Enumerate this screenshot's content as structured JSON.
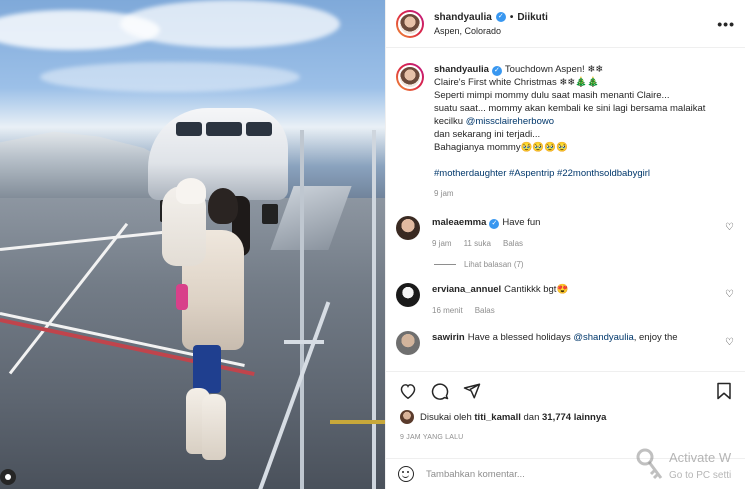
{
  "post": {
    "username": "shandyaulia",
    "follow_label": "Diikuti",
    "dot": "•",
    "location": "Aspen, Colorado",
    "more": "•••"
  },
  "caption": {
    "username": "shandyaulia",
    "lines": [
      "Touchdown Aspen! ❄❄",
      "Claire's First white Christmas ❄❄🎄🎄",
      "Seperti mimpi mommy dulu saat masih menanti Claire...",
      "suatu saat... mommy akan kembali ke sini lagi bersama malaikat",
      "kecilku "
    ],
    "mention": "@missclaireherbowo",
    "lines2": [
      "dan sekarang ini terjadi...",
      "Bahagianya mommy🥹🥹🥹🥹"
    ],
    "hashtags": "#motherdaughter #Aspentrip #22monthsoldbabygirl",
    "time": "9 jam"
  },
  "comments": [
    {
      "username": "maleaemma",
      "verified": true,
      "text": "Have fun",
      "time": "9 jam",
      "likes": "11 suka",
      "reply": "Balas",
      "replies": "Lihat balasan (7)"
    },
    {
      "username": "erviana_annuel",
      "verified": false,
      "text": "Cantikkk bgt😍",
      "time": "16 menit",
      "reply": "Balas"
    },
    {
      "username": "sawirin",
      "verified": false,
      "text": "Have a blessed holidays ",
      "mention": "@shandyaulia",
      "text2": ", enjoy the"
    }
  ],
  "likes": {
    "prefix": "Disukai oleh ",
    "user": "titi_kamall",
    "middle": " dan ",
    "count": "31,774 lainnya"
  },
  "timestamp": "9 JAM YANG LALU",
  "add_comment": {
    "placeholder": "Tambahkan komentar..."
  },
  "watermark": {
    "line1": "Activate W",
    "line2": "Go to PC setti"
  },
  "icons": {
    "heart": "heart-icon",
    "comment": "comment-icon",
    "share": "share-icon",
    "save": "bookmark-icon",
    "verified": "verified-badge-icon"
  }
}
